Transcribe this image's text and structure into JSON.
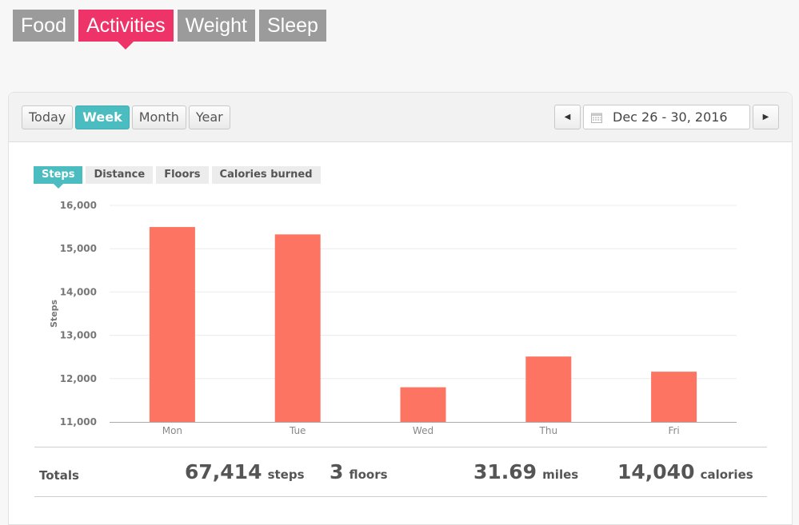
{
  "nav": {
    "tabs": [
      {
        "label": "Food"
      },
      {
        "label": "Activities"
      },
      {
        "label": "Weight"
      },
      {
        "label": "Sleep"
      }
    ],
    "active": "Activities"
  },
  "toolbar": {
    "periods": [
      "Today",
      "Week",
      "Month",
      "Year"
    ],
    "active_period": "Week",
    "date_range": "Dec 26 - 30, 2016"
  },
  "metrics": {
    "tabs": [
      "Steps",
      "Distance",
      "Floors",
      "Calories burned"
    ],
    "active": "Steps"
  },
  "colors": {
    "nav_active": "#ee3369",
    "nav_inactive": "#9b9b9b",
    "accent": "#4bbcc0",
    "bar": "#fd7462"
  },
  "chart_data": {
    "type": "bar",
    "categories": [
      "Mon",
      "Tue",
      "Wed",
      "Thu",
      "Fri"
    ],
    "values": [
      15500,
      15330,
      11800,
      12510,
      12160
    ],
    "ylabel": "Steps",
    "ylim": [
      11000,
      16000
    ],
    "yticks": [
      "11,000",
      "12,000",
      "13,000",
      "14,000",
      "15,000",
      "16,000"
    ],
    "grid": true
  },
  "totals": {
    "label": "Totals",
    "items": [
      {
        "value": "67,414",
        "unit": "steps"
      },
      {
        "value": "3",
        "unit": "floors"
      },
      {
        "value": "31.69",
        "unit": "miles"
      },
      {
        "value": "14,040",
        "unit": "calories"
      }
    ]
  }
}
